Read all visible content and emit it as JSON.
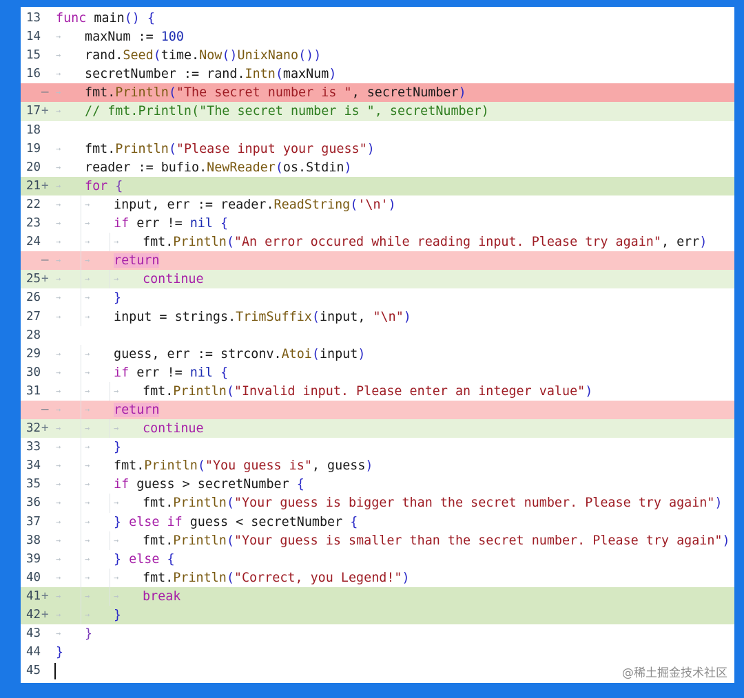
{
  "watermark": "@稀土掘金技术社区",
  "lines": [
    {
      "n": "13",
      "sign": "",
      "kind": "",
      "indent": 0,
      "segments": [
        [
          "kw",
          "func "
        ],
        [
          "",
          "main"
        ],
        [
          "bracket",
          "()"
        ],
        [
          "",
          " "
        ],
        [
          "bracket",
          "{"
        ]
      ]
    },
    {
      "n": "14",
      "sign": "",
      "kind": "",
      "indent": 1,
      "segments": [
        [
          "",
          "maxNum := "
        ],
        [
          "num",
          "100"
        ]
      ]
    },
    {
      "n": "15",
      "sign": "",
      "kind": "",
      "indent": 1,
      "segments": [
        [
          "",
          "rand."
        ],
        [
          "fn",
          "Seed"
        ],
        [
          "bracket",
          "("
        ],
        [
          "",
          "time."
        ],
        [
          "fn",
          "Now"
        ],
        [
          "bracket",
          "()"
        ],
        [
          ".",
          ""
        ],
        [
          "fn",
          "UnixNano"
        ],
        [
          "bracket",
          "())"
        ]
      ]
    },
    {
      "n": "16",
      "sign": "",
      "kind": "",
      "indent": 1,
      "segments": [
        [
          "",
          "secretNumber := rand."
        ],
        [
          "fn",
          "Intn"
        ],
        [
          "bracket",
          "("
        ],
        [
          "",
          "maxNum"
        ],
        [
          "bracket",
          ")"
        ]
      ]
    },
    {
      "n": "",
      "sign": "—",
      "kind": "del-strong",
      "indent": 1,
      "segments": [
        [
          "",
          "fmt."
        ],
        [
          "fn",
          "Println"
        ],
        [
          "bracket",
          "("
        ],
        [
          "str",
          "\"The secret number is \""
        ],
        [
          "",
          ", secretNumber"
        ],
        [
          "bracket",
          ")"
        ]
      ]
    },
    {
      "n": "17",
      "sign": "+",
      "kind": "add-light",
      "indent": 1,
      "segments": [
        [
          "comment",
          "// fmt.Println(\"The secret number is \", secretNumber)"
        ]
      ]
    },
    {
      "n": "18",
      "sign": "",
      "kind": "",
      "indent": 0,
      "segments": []
    },
    {
      "n": "19",
      "sign": "",
      "kind": "",
      "indent": 1,
      "segments": [
        [
          "",
          "fmt."
        ],
        [
          "fn",
          "Println"
        ],
        [
          "bracket",
          "("
        ],
        [
          "str",
          "\"Please input your guess\""
        ],
        [
          "bracket",
          ")"
        ]
      ]
    },
    {
      "n": "20",
      "sign": "",
      "kind": "",
      "indent": 1,
      "segments": [
        [
          "",
          "reader := bufio."
        ],
        [
          "fn",
          "NewReader"
        ],
        [
          "bracket",
          "("
        ],
        [
          "",
          "os.Stdin"
        ],
        [
          "bracket",
          ")"
        ]
      ]
    },
    {
      "n": "21",
      "sign": "+",
      "kind": "add-dark",
      "indent": 1,
      "segments": [
        [
          "kw",
          "for "
        ],
        [
          "brace-purple",
          "{"
        ]
      ]
    },
    {
      "n": "22",
      "sign": "",
      "kind": "",
      "indent": 2,
      "segments": [
        [
          "",
          "input, err := reader."
        ],
        [
          "fn",
          "ReadString"
        ],
        [
          "bracket",
          "("
        ],
        [
          "str",
          "'\\n'"
        ],
        [
          "bracket",
          ")"
        ]
      ]
    },
    {
      "n": "23",
      "sign": "",
      "kind": "",
      "indent": 2,
      "segments": [
        [
          "kw",
          "if "
        ],
        [
          "",
          "err != "
        ],
        [
          "nil",
          "nil"
        ],
        [
          "",
          " "
        ],
        [
          "bracket",
          "{"
        ]
      ]
    },
    {
      "n": "24",
      "sign": "",
      "kind": "",
      "indent": 3,
      "segments": [
        [
          "",
          "fmt."
        ],
        [
          "fn",
          "Println"
        ],
        [
          "bracket",
          "("
        ],
        [
          "str",
          "\"An error occured while reading input. Please try again\""
        ],
        [
          "",
          ", err"
        ],
        [
          "bracket",
          ")"
        ]
      ]
    },
    {
      "n": "",
      "sign": "—",
      "kind": "del-light",
      "indent": 2,
      "segments": [
        [
          "kw ret",
          "return"
        ]
      ]
    },
    {
      "n": "25",
      "sign": "+",
      "kind": "add-light",
      "indent": 3,
      "segments": [
        [
          "kw",
          "continue"
        ]
      ]
    },
    {
      "n": "26",
      "sign": "",
      "kind": "",
      "indent": 2,
      "segments": [
        [
          "bracket",
          "}"
        ]
      ]
    },
    {
      "n": "27",
      "sign": "",
      "kind": "",
      "indent": 2,
      "segments": [
        [
          "",
          "input = strings."
        ],
        [
          "fn",
          "TrimSuffix"
        ],
        [
          "bracket",
          "("
        ],
        [
          "",
          "input, "
        ],
        [
          "str",
          "\"\\n\""
        ],
        [
          "bracket",
          ")"
        ]
      ]
    },
    {
      "n": "28",
      "sign": "",
      "kind": "",
      "indent": 0,
      "segments": []
    },
    {
      "n": "29",
      "sign": "",
      "kind": "",
      "indent": 2,
      "segments": [
        [
          "",
          "guess, err := strconv."
        ],
        [
          "fn",
          "Atoi"
        ],
        [
          "bracket",
          "("
        ],
        [
          "",
          "input"
        ],
        [
          "bracket",
          ")"
        ]
      ]
    },
    {
      "n": "30",
      "sign": "",
      "kind": "",
      "indent": 2,
      "segments": [
        [
          "kw",
          "if "
        ],
        [
          "",
          "err != "
        ],
        [
          "nil",
          "nil"
        ],
        [
          "",
          " "
        ],
        [
          "bracket",
          "{"
        ]
      ]
    },
    {
      "n": "31",
      "sign": "",
      "kind": "",
      "indent": 3,
      "segments": [
        [
          "",
          "fmt."
        ],
        [
          "fn",
          "Println"
        ],
        [
          "bracket",
          "("
        ],
        [
          "str",
          "\"Invalid input. Please enter an integer value\""
        ],
        [
          "bracket",
          ")"
        ]
      ]
    },
    {
      "n": "",
      "sign": "—",
      "kind": "del-light",
      "indent": 2,
      "segments": [
        [
          "kw ret",
          "return"
        ]
      ]
    },
    {
      "n": "32",
      "sign": "+",
      "kind": "add-light",
      "indent": 3,
      "segments": [
        [
          "kw",
          "continue"
        ]
      ]
    },
    {
      "n": "33",
      "sign": "",
      "kind": "",
      "indent": 2,
      "segments": [
        [
          "bracket",
          "}"
        ]
      ]
    },
    {
      "n": "34",
      "sign": "",
      "kind": "",
      "indent": 2,
      "segments": [
        [
          "",
          "fmt."
        ],
        [
          "fn",
          "Println"
        ],
        [
          "bracket",
          "("
        ],
        [
          "str",
          "\"You guess is\""
        ],
        [
          "",
          ", guess"
        ],
        [
          "bracket",
          ")"
        ]
      ]
    },
    {
      "n": "35",
      "sign": "",
      "kind": "",
      "indent": 2,
      "segments": [
        [
          "kw",
          "if "
        ],
        [
          "",
          "guess > secretNumber "
        ],
        [
          "bracket",
          "{"
        ]
      ]
    },
    {
      "n": "36",
      "sign": "",
      "kind": "",
      "indent": 3,
      "segments": [
        [
          "",
          "fmt."
        ],
        [
          "fn",
          "Println"
        ],
        [
          "bracket",
          "("
        ],
        [
          "str",
          "\"Your guess is bigger than the secret number. Please try again\""
        ],
        [
          "bracket",
          ")"
        ]
      ]
    },
    {
      "n": "37",
      "sign": "",
      "kind": "",
      "indent": 2,
      "segments": [
        [
          "bracket",
          "} "
        ],
        [
          "kw",
          "else if "
        ],
        [
          "",
          "guess < secretNumber "
        ],
        [
          "bracket",
          "{"
        ]
      ]
    },
    {
      "n": "38",
      "sign": "",
      "kind": "",
      "indent": 3,
      "segments": [
        [
          "",
          "fmt."
        ],
        [
          "fn",
          "Println"
        ],
        [
          "bracket",
          "("
        ],
        [
          "str",
          "\"Your guess is smaller than the secret number. Please try again\""
        ],
        [
          "bracket",
          ")"
        ]
      ]
    },
    {
      "n": "39",
      "sign": "",
      "kind": "",
      "indent": 2,
      "segments": [
        [
          "bracket",
          "} "
        ],
        [
          "kw",
          "else "
        ],
        [
          "bracket",
          "{"
        ]
      ]
    },
    {
      "n": "40",
      "sign": "",
      "kind": "",
      "indent": 3,
      "segments": [
        [
          "",
          "fmt."
        ],
        [
          "fn",
          "Println"
        ],
        [
          "bracket",
          "("
        ],
        [
          "str",
          "\"Correct, you Legend!\""
        ],
        [
          "bracket",
          ")"
        ]
      ]
    },
    {
      "n": "41",
      "sign": "+",
      "kind": "add-dark",
      "indent": 3,
      "segments": [
        [
          "kw",
          "break"
        ]
      ]
    },
    {
      "n": "42",
      "sign": "+",
      "kind": "add-dark",
      "indent": 2,
      "segments": [
        [
          "bracket",
          "}"
        ]
      ]
    },
    {
      "n": "43",
      "sign": "",
      "kind": "",
      "indent": 1,
      "segments": [
        [
          "brace-purple",
          "}"
        ]
      ]
    },
    {
      "n": "44",
      "sign": "",
      "kind": "",
      "indent": 0,
      "segments": [
        [
          "bracket",
          "}"
        ]
      ]
    },
    {
      "n": "45",
      "sign": "",
      "kind": "",
      "indent": 0,
      "segments": []
    }
  ]
}
